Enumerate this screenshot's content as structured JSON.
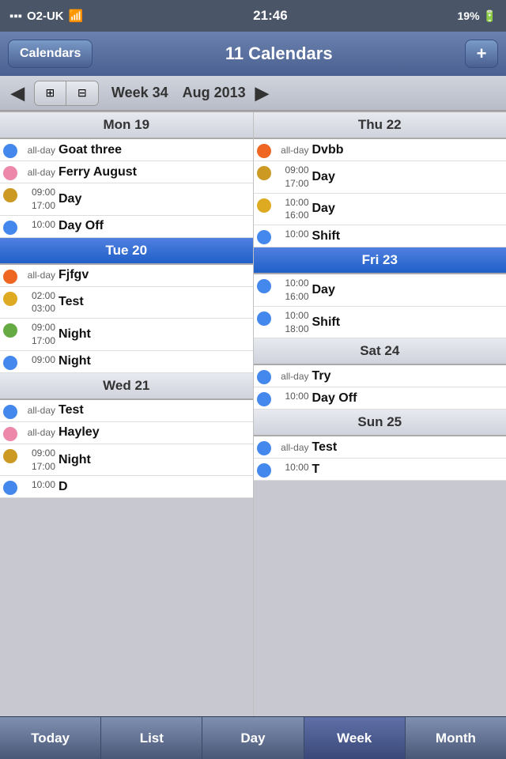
{
  "statusBar": {
    "carrier": "O2-UK",
    "time": "21:46",
    "battery": "19%"
  },
  "header": {
    "calendarsLabel": "Calendars",
    "title": "11 Calendars",
    "addLabel": "+"
  },
  "navBar": {
    "leftArrow": "◀",
    "rightArrow": "▶",
    "week": "Week 34",
    "month": "Aug 2013",
    "view1": "⊞",
    "view2": "⊟"
  },
  "columns": [
    {
      "id": "col-left",
      "days": [
        {
          "label": "Mon 19",
          "isToday": false,
          "events": [
            {
              "dot": "blue",
              "time": "all-day",
              "name": "Goat three"
            },
            {
              "dot": "pink",
              "time": "all-day",
              "name": "Ferry August"
            },
            {
              "dot": "gold",
              "time": "09:00\n17:00",
              "name": "Day"
            },
            {
              "dot": "blue",
              "time": "10:00",
              "name": "Day Off",
              "partial": true
            }
          ]
        },
        {
          "label": "Tue 20",
          "isToday": true,
          "events": [
            {
              "dot": "orange",
              "time": "all-day",
              "name": "Fjfgv"
            },
            {
              "dot": "yellow",
              "time": "02:00\n03:00",
              "name": "Test"
            },
            {
              "dot": "green",
              "time": "09:00\n17:00",
              "name": "Night"
            },
            {
              "dot": "blue",
              "time": "09:00",
              "name": "Night",
              "partial": true
            }
          ]
        },
        {
          "label": "Wed 21",
          "isToday": false,
          "events": [
            {
              "dot": "blue",
              "time": "all-day",
              "name": "Test"
            },
            {
              "dot": "pink",
              "time": "all-day",
              "name": "Hayley"
            },
            {
              "dot": "gold",
              "time": "09:00\n17:00",
              "name": "Night"
            },
            {
              "dot": "blue",
              "time": "10:00",
              "name": "D",
              "partial": true
            }
          ]
        }
      ]
    },
    {
      "id": "col-right",
      "days": [
        {
          "label": "Thu 22",
          "isToday": false,
          "events": [
            {
              "dot": "orange",
              "time": "all-day",
              "name": "Dvbb"
            },
            {
              "dot": "gold",
              "time": "09:00\n17:00",
              "name": "Day"
            },
            {
              "dot": "yellow",
              "time": "10:00\n16:00",
              "name": "Day"
            },
            {
              "dot": "blue",
              "time": "10:00",
              "name": "Shift",
              "partial": true
            }
          ]
        },
        {
          "label": "Fri 23",
          "isToday": true,
          "events": [
            {
              "dot": "blue",
              "time": "10:00\n16:00",
              "name": "Day"
            },
            {
              "dot": "blue",
              "time": "10:00\n18:00",
              "name": "Shift"
            }
          ]
        },
        {
          "label": "Sat 24",
          "isToday": false,
          "events": [
            {
              "dot": "blue",
              "time": "all-day",
              "name": "Try"
            },
            {
              "dot": "blue",
              "time": "10:00",
              "name": "Day Off",
              "partial": true
            }
          ]
        },
        {
          "label": "Sun 25",
          "isToday": false,
          "events": [
            {
              "dot": "blue",
              "time": "all-day",
              "name": "Test"
            },
            {
              "dot": "blue",
              "time": "10:00",
              "name": "T",
              "partial": true
            }
          ]
        }
      ]
    }
  ],
  "tabs": [
    {
      "label": "Today",
      "active": false
    },
    {
      "label": "List",
      "active": false
    },
    {
      "label": "Day",
      "active": false
    },
    {
      "label": "Week",
      "active": true
    },
    {
      "label": "Month",
      "active": false
    }
  ]
}
